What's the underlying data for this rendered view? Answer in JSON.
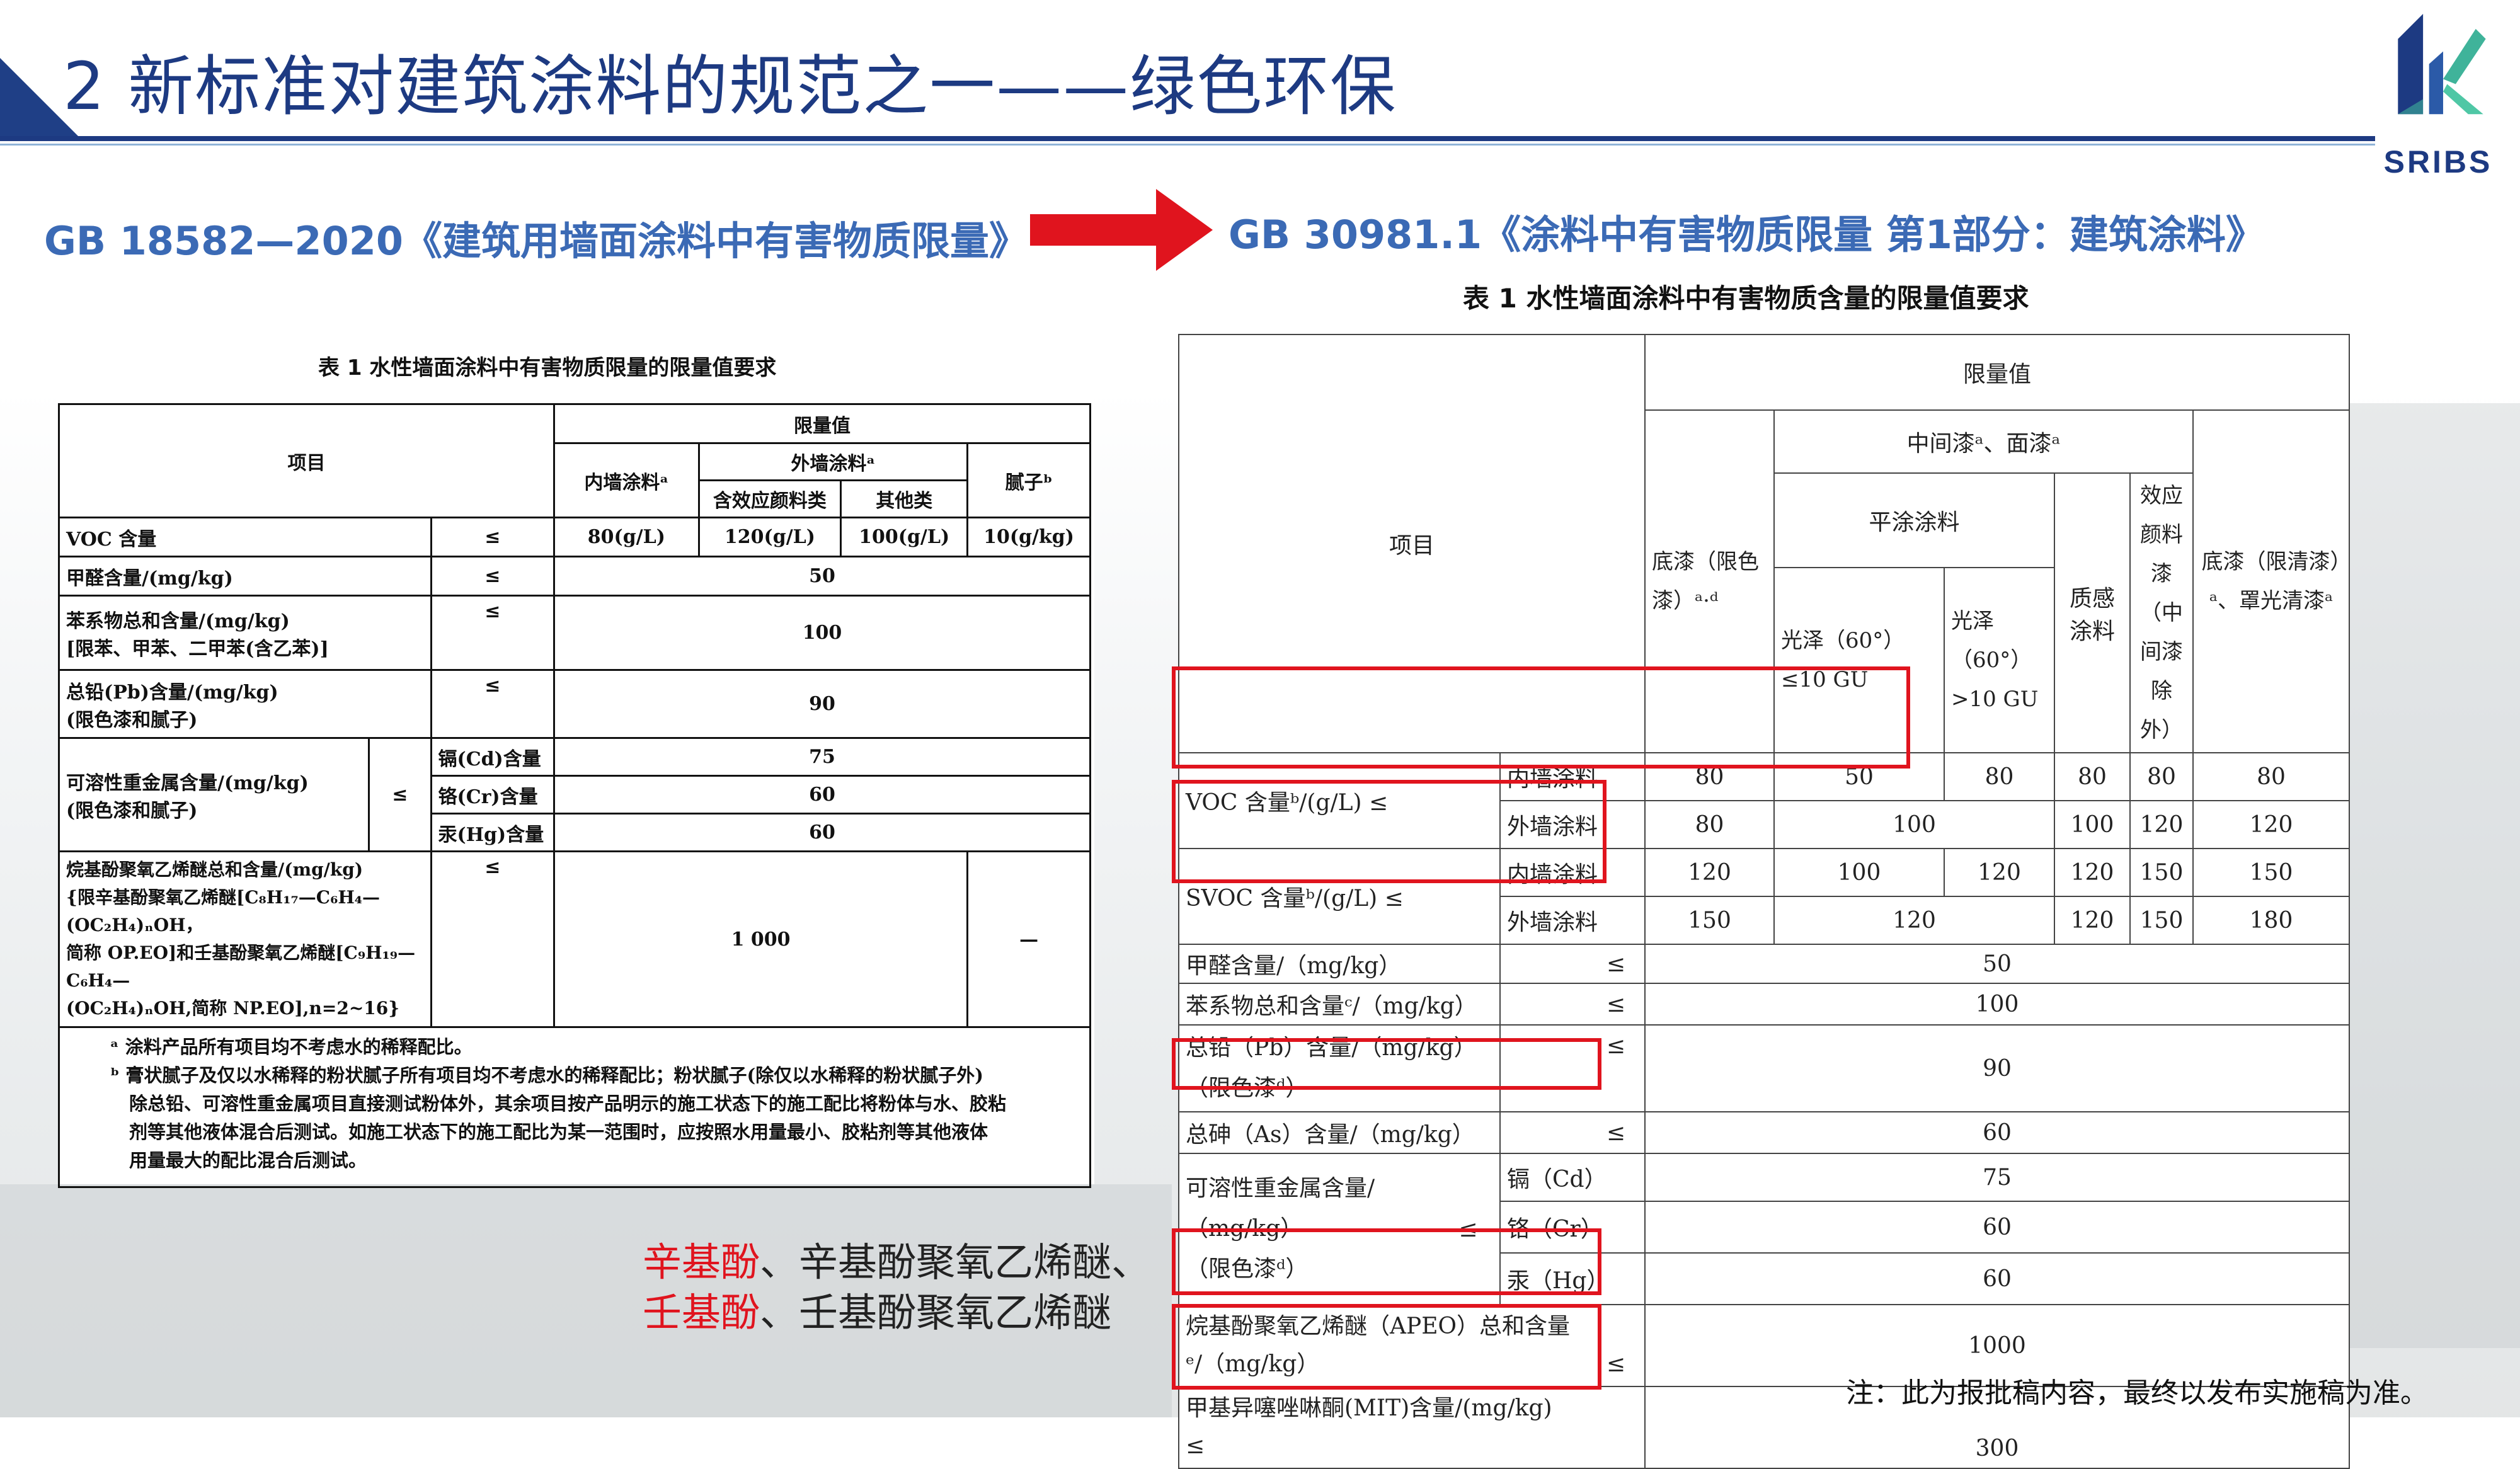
{
  "header": {
    "title": "2 新标准对建筑涂料的规范之一——绿色环保",
    "logo_text": "SRIBS"
  },
  "standards": {
    "old": "GB 18582—2020《建筑用墙面涂料中有害物质限量》",
    "new": "GB 30981.1《涂料中有害物质限量 第1部分：建筑涂料》"
  },
  "left_table": {
    "caption": "表 1   水性墙面涂料中有害物质限量的限量值要求",
    "h_item": "项目",
    "h_limit": "限量值",
    "h_interior": "内墙涂料ᵃ",
    "h_exterior": "外墙涂料ᵃ",
    "h_effect": "含效应颜料类",
    "h_other": "其他类",
    "h_putty": "腻子ᵇ",
    "rows": {
      "voc_label": "VOC 含量",
      "voc_interior": "80(g/L)",
      "voc_effect": "120(g/L)",
      "voc_other": "100(g/L)",
      "voc_putty": "10(g/kg)",
      "hcho_label": "甲醛含量/(mg/kg)",
      "hcho_value": "50",
      "benzene_label": "苯系物总和含量/(mg/kg)",
      "benzene_sub": "[限苯、甲苯、二甲苯(含乙苯)]",
      "benzene_value": "100",
      "pb_label": "总铅(Pb)含量/(mg/kg)",
      "pb_sub": "(限色漆和腻子)",
      "pb_value": "90",
      "hm_label": "可溶性重金属含量/(mg/kg)",
      "hm_sub": "(限色漆和腻子)",
      "cd_label": "镉(Cd)含量",
      "cd_value": "75",
      "cr_label": "铬(Cr)含量",
      "cr_value": "60",
      "hg_label": "汞(Hg)含量",
      "hg_value": "60",
      "ape_l1": "烷基酚聚氧乙烯醚总和含量/(mg/kg)",
      "ape_l2": "{限辛基酚聚氧乙烯醚[C₈H₁₇—C₆H₄—(OC₂H₄)ₙOH，",
      "ape_l3": "简称 OP.EO]和壬基酚聚氧乙烯醚[C₉H₁₉—C₆H₄—",
      "ape_l4": "(OC₂H₄)ₙOH,简称 NP.EO],n=2~16}",
      "ape_value": "1 000",
      "ape_putty": "—",
      "le": "≤"
    },
    "note_a": "ᵃ  涂料产品所有项目均不考虑水的稀释配比。",
    "note_b1": "ᵇ  膏状腻子及仅以水稀释的粉状腻子所有项目均不考虑水的稀释配比；粉状腻子(除仅以水稀释的粉状腻子外)",
    "note_b2": "除总铅、可溶性重金属项目直接测试粉体外，其余项目按产品明示的施工状态下的施工配比将粉体与水、胶粘",
    "note_b3": "剂等其他液体混合后测试。如施工状态下的施工配比为某一范围时，应按照水用量最小、胶粘剂等其他液体",
    "note_b4": "用量最大的配比混合后测试。"
  },
  "right_table": {
    "caption": "表 1   水性墙面涂料中有害物质含量的限量值要求",
    "h_item": "项目",
    "h_limit": "限量值",
    "h_primer": "底漆（限色漆）ᵃ·ᵈ",
    "h_mid_top": "中间漆ᵃ、面漆ᵃ",
    "h_flat": "平涂涂料",
    "h_gloss_low": "光泽（60°）≤10 GU",
    "h_gloss_high": "光泽（60°）>10 GU",
    "h_texture": "质感涂料",
    "h_effect": "效应颜料漆（中间漆除外）",
    "h_clear": "底漆（限清漆）ᵃ、罩光清漆ᵃ",
    "voc_label": "VOC 含量ᵇ/(g/L)  ≤",
    "svoc_label": "SVOC 含量ᵇ/(g/L) ≤",
    "interior": "内墙涂料",
    "exterior": "外墙涂料",
    "voc_int": [
      "80",
      "50",
      "80",
      "80",
      "80",
      "80"
    ],
    "voc_ext": [
      "80",
      "100",
      "100",
      "120",
      "120"
    ],
    "svoc_int": [
      "120",
      "100",
      "120",
      "120",
      "150",
      "150"
    ],
    "svoc_ext": [
      "150",
      "120",
      "120",
      "150",
      "180"
    ],
    "hcho_label": "甲醛含量/（mg/kg）",
    "hcho_value": "50",
    "benzene_label": "苯系物总和含量ᶜ/（mg/kg）",
    "benzene_value": "100",
    "pb_label": "总铅（Pb）含量/（mg/kg）",
    "pb_sub": "（限色漆ᵈ）",
    "pb_value": "90",
    "as_label": "总砷（As）含量/（mg/kg）",
    "as_value": "60",
    "hm_l1": "可溶性重金属含量/",
    "hm_l2": "（mg/kg）",
    "hm_l3": "（限色漆ᵈ）",
    "cd_label": "镉（Cd）",
    "cd_value": "75",
    "cr_label": "铬（Cr）",
    "cr_value": "60",
    "hg_label": "汞（Hg）",
    "hg_value": "60",
    "apeo_l1": "烷基酚聚氧乙烯醚（APEO）总和含量",
    "apeo_l2": "ᵉ/（mg/kg）",
    "apeo_value": "1000",
    "mit_label": "甲基异噻唑啉酮(MIT)含量/(mg/kg)",
    "mit_value": "300",
    "le": "≤"
  },
  "bottom": {
    "line1_red": "辛基酚",
    "line1_rest": "、辛基酚聚氧乙烯醚、",
    "line2_red": "壬基酚",
    "line2_rest": "、壬基酚聚氧乙烯醚",
    "note": "注：此为报批稿内容，最终以发布实施稿为准。"
  },
  "colors": {
    "brand_blue": "#1d3a82",
    "subtitle_blue": "#3b6ab5",
    "highlight_red": "#e0141e"
  }
}
